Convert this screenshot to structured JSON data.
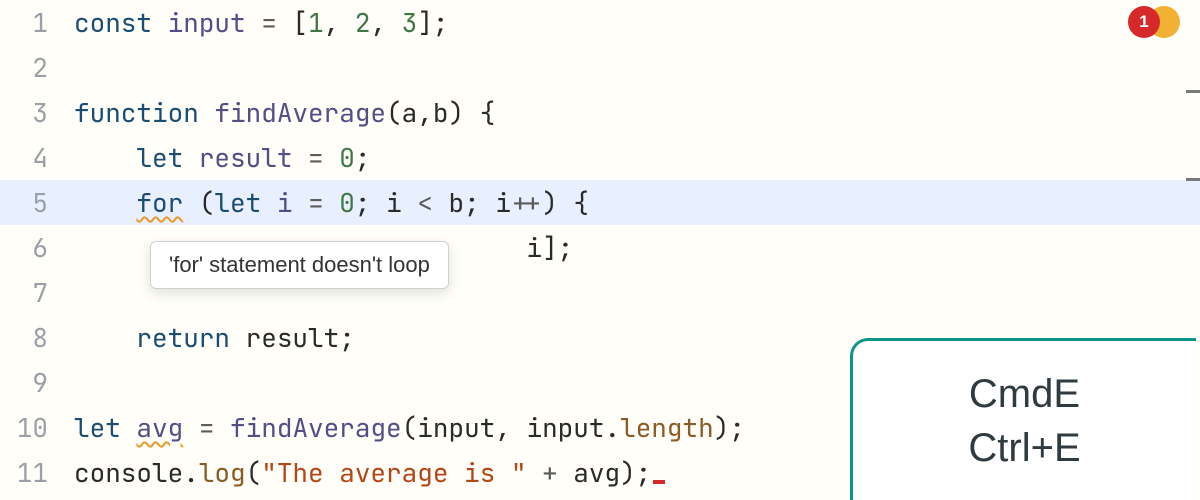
{
  "gutter": [
    "1",
    "2",
    "3",
    "4",
    "5",
    "6",
    "7",
    "8",
    "9",
    "10",
    "11"
  ],
  "code": {
    "l1": {
      "const": "const",
      "sp": " ",
      "input": "input",
      "eq": " = ",
      "lb": "[",
      "n1": "1",
      "c1": ", ",
      "n2": "2",
      "c2": ", ",
      "n3": "3",
      "rb": "]",
      "semi": ";"
    },
    "l3": {
      "function": "function",
      "sp": " ",
      "name": "findAverage",
      "lp": "(",
      "a": "a",
      "c": ",",
      "b": "b",
      "rp": ")",
      "sp2": " ",
      "lc": "{"
    },
    "l4": {
      "indent": "    ",
      "let": "let",
      "sp": " ",
      "result": "result",
      "eq": " = ",
      "zero": "0",
      "semi": ";"
    },
    "l5": {
      "indent": "    ",
      "for": "for",
      "sp": " ",
      "lp": "(",
      "let": "let",
      "sp2": " ",
      "i": "i",
      "eq": " = ",
      "zero": "0",
      "semi1": "; ",
      "i2": "i",
      "lt": " < ",
      "b": "b",
      "semi2": "; ",
      "i3": "i",
      "pp": "++",
      "rp": ")",
      "sp3": " ",
      "lc": "{"
    },
    "l6": {
      "hidden_tail": "i];"
    },
    "l8": {
      "indent": "    ",
      "return": "return",
      "sp": " ",
      "result": "result",
      "semi": ";"
    },
    "l10": {
      "let": "let",
      "sp": " ",
      "avg": "avg",
      "eq": " = ",
      "fn": "findAverage",
      "lp": "(",
      "input": "input",
      "c": ", ",
      "input2": "input",
      "dot": ".",
      "length": "length",
      "rp": ")",
      "semi": ";"
    },
    "l11": {
      "console": "console",
      "dot": ".",
      "log": "log",
      "lp": "(",
      "str": "\"The average is \"",
      "plus": " + ",
      "avg": "avg",
      "rp": ")",
      "semi": ";"
    }
  },
  "tooltip": "'for' statement doesn't loop",
  "badges": {
    "red": "1"
  },
  "hint": {
    "line1": "CmdE",
    "line2": "Ctrl+E"
  }
}
